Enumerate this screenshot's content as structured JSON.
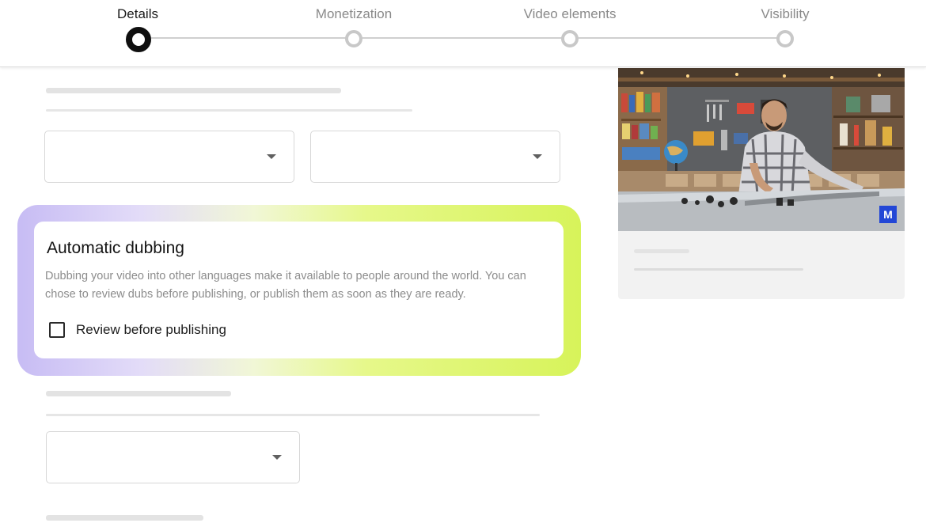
{
  "stepper": {
    "steps": [
      {
        "label": "Details",
        "active": true
      },
      {
        "label": "Monetization",
        "active": false
      },
      {
        "label": "Video elements",
        "active": false
      },
      {
        "label": "Visibility",
        "active": false
      }
    ]
  },
  "dubbing": {
    "title": "Automatic dubbing",
    "description": "Dubbing your video into other languages make it available to people around the world. You can chose to review dubs before publishing, or publish them as soon as they are ready.",
    "checkbox_label": "Review before publishing",
    "checkbox_checked": false
  },
  "preview": {
    "badge": "M"
  },
  "colors": {
    "accent_lavender": "#c7bcf4",
    "accent_lime": "#d7f35a",
    "badge_blue": "#2347d6"
  },
  "icons": {
    "dropdown": "chevron-down-icon",
    "checkbox": "checkbox-unchecked-icon"
  }
}
